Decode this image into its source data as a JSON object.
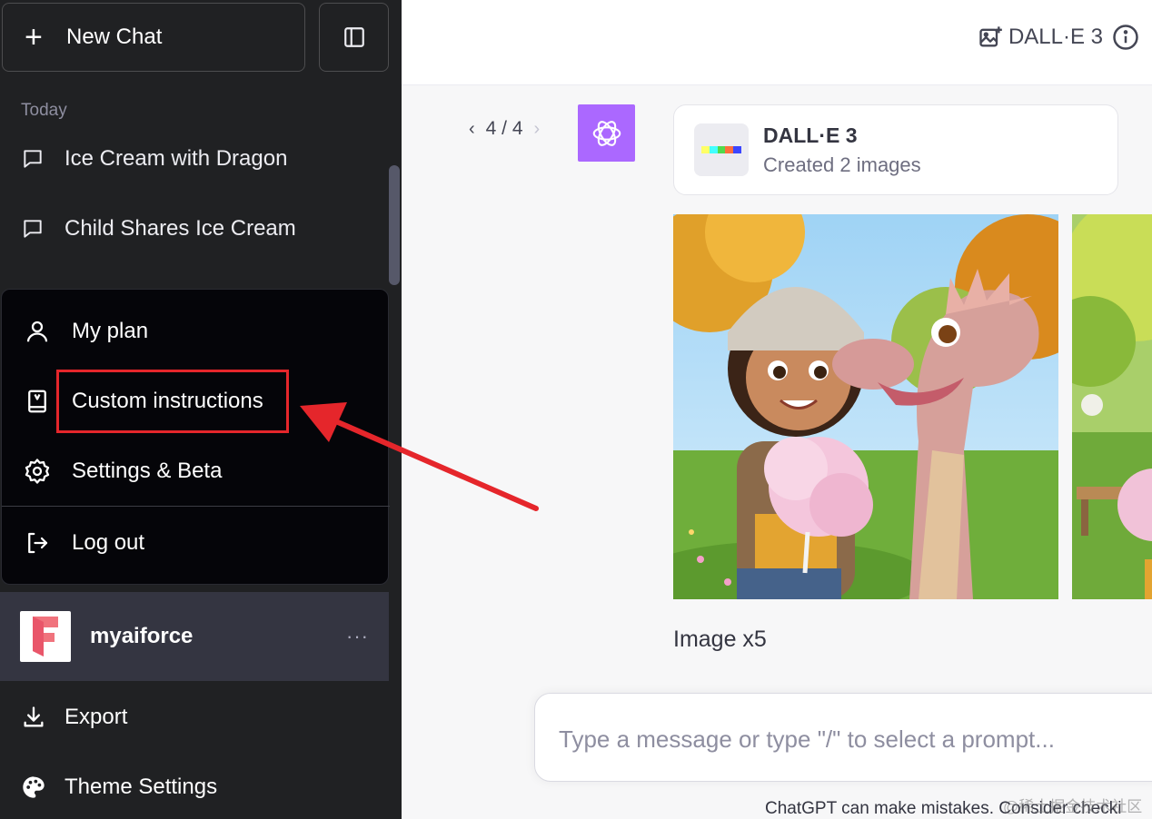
{
  "sidebar": {
    "new_chat_label": "New Chat",
    "section_today": "Today",
    "chats": [
      {
        "title": "Ice Cream with Dragon"
      },
      {
        "title": "Child Shares Ice Cream"
      }
    ],
    "menu": {
      "my_plan": "My plan",
      "custom_instructions": "Custom instructions",
      "settings": "Settings & Beta",
      "logout": "Log out"
    },
    "user": {
      "name": "myaiforce",
      "more": "···"
    },
    "export_label": "Export",
    "theme_label": "Theme Settings"
  },
  "header": {
    "model": "DALL·E 3"
  },
  "conversation": {
    "pager": "4 / 4",
    "plugin_card": {
      "title": "DALL·E 3",
      "subtitle": "Created 2 images"
    },
    "image_count": "Image x5"
  },
  "composer": {
    "placeholder": "Type a message or type \"/\" to select a prompt..."
  },
  "footer": {
    "disclaimer": "ChatGPT can make mistakes. Consider checki",
    "watermark": "@稀土掘金技术社区"
  },
  "colors": {
    "sidebar_bg": "#202123",
    "menu_bg": "#050509",
    "accent_purple": "#ab68ff",
    "highlight_red": "#e5262b",
    "user_row_bg": "#343541"
  }
}
